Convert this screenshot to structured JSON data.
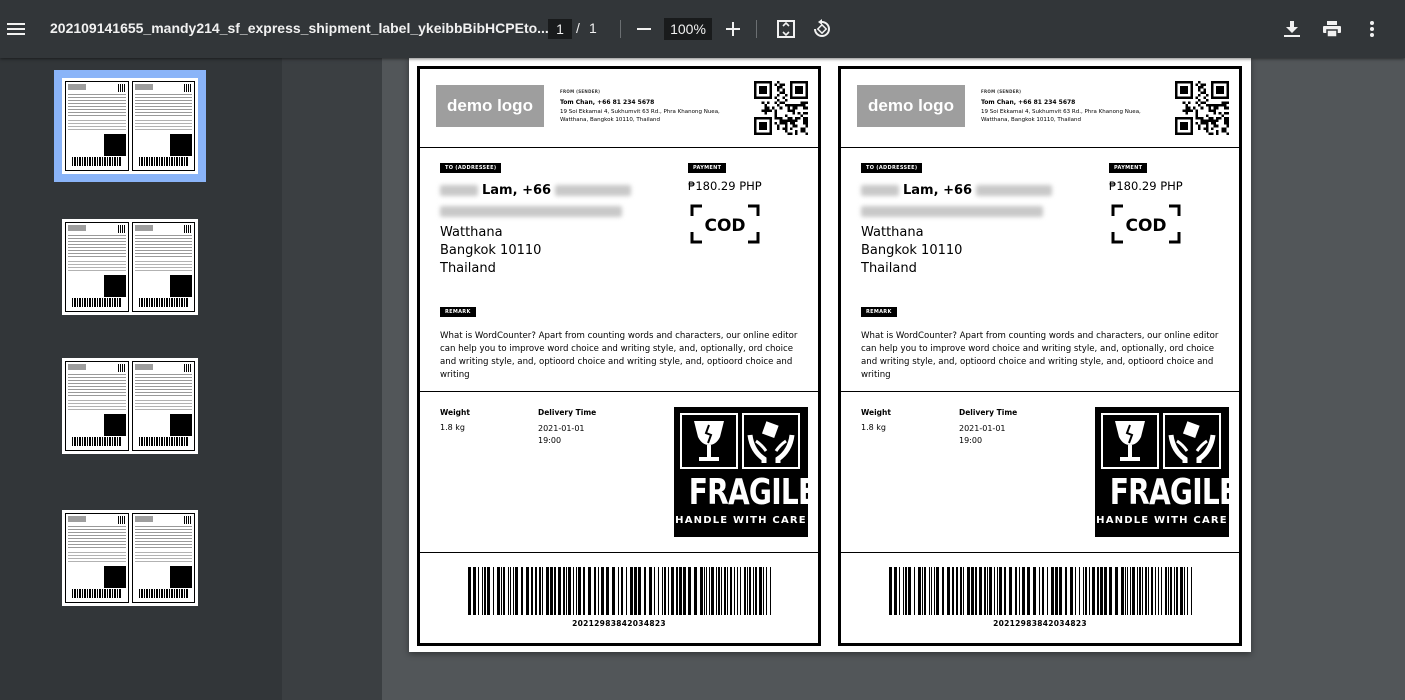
{
  "toolbar": {
    "title": "202109141655_mandy214_sf_express_shipment_label_ykeibbBibHCPEto...",
    "page_current": "1",
    "page_separator": "/",
    "page_total": "1",
    "zoom": "100%",
    "icons": [
      "menu-icon",
      "minus-icon",
      "plus-icon",
      "fit-page-icon",
      "rotate-icon",
      "download-icon",
      "print-icon",
      "more-vert-icon"
    ]
  },
  "labels": [
    {
      "logo": "demo logo",
      "from_title": "FROM (SENDER)",
      "from_name": "Tom Chan, +66 81 234 5678",
      "from_address": "19 Soi Ekkamai 4, Sukhumvit 63 Rd., Phra Khanong Nuea, Watthana, Bangkok 10110, Thailand",
      "to_title": "TO (ADDRESSEE)",
      "to_name_visible": "Lam, +66",
      "to_city": "Watthana",
      "to_postal": "Bangkok 10110",
      "to_country": "Thailand",
      "payment_title": "PAYMENT",
      "payment_amount": "₱180.29 PHP",
      "cod": "COD",
      "remark_title": "REMARK",
      "remark_text": "What is WordCounter? Apart from counting words and characters, our online editor can help you to improve word choice and writing style, and, optionally, ord choice and writing style, and, optioord choice and writing style, and, optioord choice and writing",
      "weight_label": "Weight",
      "weight_value": "1.8 kg",
      "delivery_label": "Delivery Time",
      "delivery_date": "2021-01-01",
      "delivery_time": "19:00",
      "fragile": "FRAGILE",
      "fragile_sub": "HANDLE WITH CARE",
      "tracking": "20212983842034823"
    },
    {
      "logo": "demo logo",
      "from_title": "FROM (SENDER)",
      "from_name": "Tom Chan, +66 81 234 5678",
      "from_address": "19 Soi Ekkamai 4, Sukhumvit 63 Rd., Phra Khanong Nuea, Watthana, Bangkok 10110, Thailand",
      "to_title": "TO (ADDRESSEE)",
      "to_name_visible": "Lam, +66",
      "to_city": "Watthana",
      "to_postal": "Bangkok 10110",
      "to_country": "Thailand",
      "payment_title": "PAYMENT",
      "payment_amount": "₱180.29 PHP",
      "cod": "COD",
      "remark_title": "REMARK",
      "remark_text": "What is WordCounter? Apart from counting words and characters, our online editor can help you to improve word choice and writing style, and, optionally, ord choice and writing style, and, optioord choice and writing style, and, optioord choice and writing",
      "weight_label": "Weight",
      "weight_value": "1.8 kg",
      "delivery_label": "Delivery Time",
      "delivery_date": "2021-01-01",
      "delivery_time": "19:00",
      "fragile": "FRAGILE",
      "fragile_sub": "HANDLE WITH CARE",
      "tracking": "20212983842034823"
    }
  ],
  "colors": {
    "toolbar_bg": "#323639",
    "viewer_bg": "#525659",
    "thumb_selected": "#8ab4f8"
  }
}
